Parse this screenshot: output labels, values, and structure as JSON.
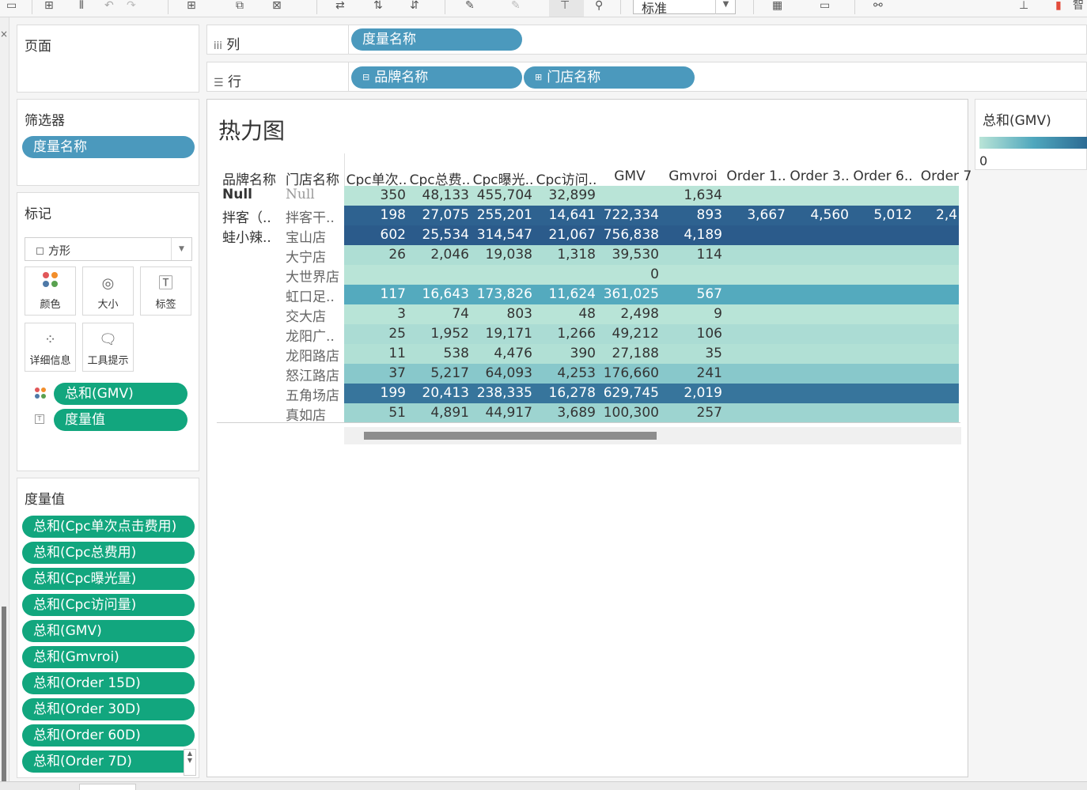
{
  "toolbar": {
    "zoom_select": "标准"
  },
  "panels": {
    "pages": {
      "title": "页面"
    },
    "filters": {
      "title": "筛选器",
      "pills": [
        "度量名称"
      ]
    },
    "marks": {
      "title": "标记",
      "type": "方形",
      "buttons": {
        "color": "颜色",
        "size": "大小",
        "label": "标签",
        "detail": "详细信息",
        "tooltip": "工具提示"
      },
      "fields": [
        "总和(GMV)",
        "度量值"
      ]
    },
    "measure_values": {
      "title": "度量值",
      "items": [
        "总和(Cpc单次点击费用)",
        "总和(Cpc总费用)",
        "总和(Cpc曝光量)",
        "总和(Cpc访问量)",
        "总和(GMV)",
        "总和(Gmvroi)",
        "总和(Order 15D)",
        "总和(Order 30D)",
        "总和(Order 60D)",
        "总和(Order 7D)"
      ]
    }
  },
  "shelves": {
    "columns": {
      "label": "列",
      "pills": [
        "度量名称"
      ]
    },
    "rows": {
      "label": "行",
      "pills": [
        "品牌名称",
        "门店名称"
      ]
    }
  },
  "view": {
    "title": "热力图",
    "row_headers": [
      "品牌名称",
      "门店名称"
    ],
    "col_headers": [
      "Cpc单次..",
      "Cpc总费..",
      "Cpc曝光..",
      "Cpc访问..",
      "GMV",
      "Gmvroi",
      "Order 1..",
      "Order 3..",
      "Order 6..",
      "Order 7"
    ]
  },
  "legend": {
    "title": "总和(GMV)",
    "min_label": "0"
  },
  "chart_data": {
    "type": "heatmap",
    "title": "热力图",
    "color_measure": "总和(GMV)",
    "color_range": [
      "#b9e4d7",
      "#2b5b8b"
    ],
    "columns": [
      "Cpc单次..",
      "Cpc总费..",
      "Cpc曝光..",
      "Cpc访问..",
      "GMV",
      "Gmvroi",
      "Order 1..",
      "Order 3..",
      "Order 6..",
      "Order 7"
    ],
    "rows": [
      {
        "brand": "Null",
        "store": "Null",
        "gmv": 0,
        "cells": [
          "350",
          "48,133",
          "455,704",
          "32,899",
          "",
          "1,634",
          "",
          "",
          "",
          ""
        ]
      },
      {
        "brand": "拌客（..",
        "store": "拌客干..",
        "gmv": 722334,
        "cells": [
          "198",
          "27,075",
          "255,201",
          "14,641",
          "722,334",
          "893",
          "3,667",
          "4,560",
          "5,012",
          "2,4"
        ]
      },
      {
        "brand": "蛙小辣..",
        "store": "宝山店",
        "gmv": 756838,
        "cells": [
          "602",
          "25,534",
          "314,547",
          "21,067",
          "756,838",
          "4,189",
          "",
          "",
          "",
          ""
        ]
      },
      {
        "brand": "",
        "store": "大宁店",
        "gmv": 39530,
        "cells": [
          "26",
          "2,046",
          "19,038",
          "1,318",
          "39,530",
          "114",
          "",
          "",
          "",
          ""
        ]
      },
      {
        "brand": "",
        "store": "大世界店",
        "gmv": 0,
        "cells": [
          "",
          "",
          "",
          "",
          "0",
          "",
          "",
          "",
          "",
          ""
        ]
      },
      {
        "brand": "",
        "store": "虹口足..",
        "gmv": 361025,
        "cells": [
          "117",
          "16,643",
          "173,826",
          "11,624",
          "361,025",
          "567",
          "",
          "",
          "",
          ""
        ]
      },
      {
        "brand": "",
        "store": "交大店",
        "gmv": 2498,
        "cells": [
          "3",
          "74",
          "803",
          "48",
          "2,498",
          "9",
          "",
          "",
          "",
          ""
        ]
      },
      {
        "brand": "",
        "store": "龙阳广..",
        "gmv": 49212,
        "cells": [
          "25",
          "1,952",
          "19,171",
          "1,266",
          "49,212",
          "106",
          "",
          "",
          "",
          ""
        ]
      },
      {
        "brand": "",
        "store": "龙阳路店",
        "gmv": 27188,
        "cells": [
          "11",
          "538",
          "4,476",
          "390",
          "27,188",
          "35",
          "",
          "",
          "",
          ""
        ]
      },
      {
        "brand": "",
        "store": "怒江路店",
        "gmv": 176660,
        "cells": [
          "37",
          "5,217",
          "64,093",
          "4,253",
          "176,660",
          "241",
          "",
          "",
          "",
          ""
        ]
      },
      {
        "brand": "",
        "store": "五角场店",
        "gmv": 629745,
        "cells": [
          "199",
          "20,413",
          "238,335",
          "16,278",
          "629,745",
          "2,019",
          "",
          "",
          "",
          ""
        ]
      },
      {
        "brand": "",
        "store": "真如店",
        "gmv": 100300,
        "cells": [
          "51",
          "4,891",
          "44,917",
          "3,689",
          "100,300",
          "257",
          "",
          "",
          "",
          ""
        ]
      }
    ]
  }
}
